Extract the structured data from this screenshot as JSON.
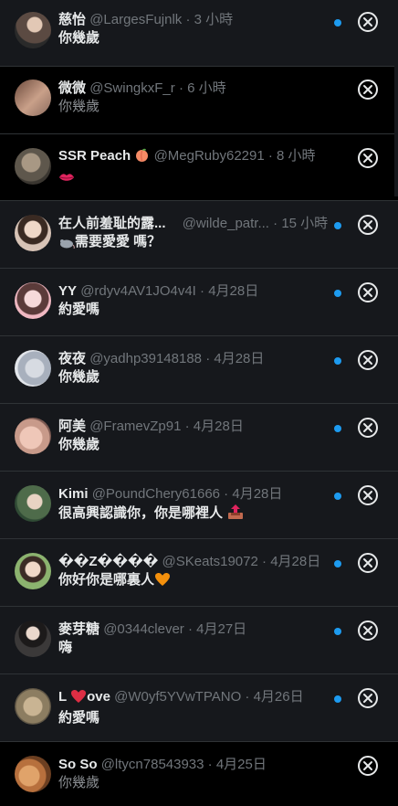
{
  "notifications": [
    {
      "name": "慈怡",
      "handle": "@LargesFujnlk",
      "time": "3 小時",
      "message": "你幾歲",
      "unread": true
    },
    {
      "name": "微微",
      "handle": "@SwingkxF_r",
      "time": "6 小時",
      "message": "你幾歲",
      "unread": false
    },
    {
      "name": "SSR Peach",
      "handle": "@MegRuby62291",
      "time": "8 小時",
      "message": "",
      "unread": false
    },
    {
      "name": "在人前羞耻的露...",
      "handle": "@wilde_patr...",
      "time": "15 小時",
      "message": "需要愛愛 嗎？",
      "unread": true
    },
    {
      "name": "YY",
      "handle": "@rdyv4AV1JO4v4I",
      "time": "4月28日",
      "message": "約愛嗎",
      "unread": true
    },
    {
      "name": "夜夜",
      "handle": "@yadhp39148188",
      "time": "4月28日",
      "message": "你幾歲",
      "unread": true
    },
    {
      "name": "阿美",
      "handle": "@FramevZp91",
      "time": "4月28日",
      "message": "你幾歲",
      "unread": true
    },
    {
      "name": "Kimi",
      "handle": "@PoundChery61666",
      "time": "4月28日",
      "message": "很高興認識你，你是哪裡人",
      "unread": true
    },
    {
      "name": "��Z����",
      "handle": "@SKeats19072",
      "time": "4月28日",
      "message": "你好你是哪裏人",
      "unread": true
    },
    {
      "name": "麥芽糖",
      "handle": "@0344clever",
      "time": "4月27日",
      "message": "嗨",
      "unread": true
    },
    {
      "name": "L  ove",
      "handle": "@W0yf5YVwTPANO",
      "time": "4月26日",
      "message": "約愛嗎",
      "unread": true
    },
    {
      "name": "So So",
      "handle": "@ltycn78543933",
      "time": "4月25日",
      "message": "你幾歲",
      "unread": false
    }
  ],
  "separator": " · ",
  "colors": {
    "accent": "#1d9bf0",
    "text": "#e7e9ea",
    "muted": "#71767b",
    "unread_bg": "#16181c",
    "read_bg": "#000000"
  }
}
